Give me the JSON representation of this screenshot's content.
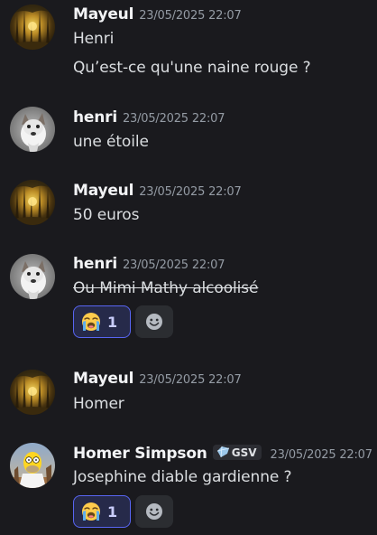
{
  "messages": [
    {
      "author": "Mayeul",
      "timestamp": "23/05/2025 22:07",
      "lines": [
        "Henri",
        "Qu’est-ce qu'une naine rouge ?"
      ],
      "avatar": "forest-avatar"
    },
    {
      "author": "henri",
      "timestamp": "23/05/2025 22:07",
      "lines": [
        "une étoile"
      ],
      "avatar": "dog-avatar"
    },
    {
      "author": "Mayeul",
      "timestamp": "23/05/2025 22:07",
      "lines": [
        "50 euros"
      ],
      "avatar": "forest-avatar"
    },
    {
      "author": "henri",
      "timestamp": "23/05/2025 22:07",
      "lines": [
        "Ou Mimi Mathy alcoolisé"
      ],
      "strikethrough": true,
      "avatar": "dog-avatar",
      "reactions": [
        {
          "emoji": "😭",
          "icon": "loudly-crying-face-icon",
          "count": "1"
        }
      ],
      "add_reaction_icon": "smiley-face-icon"
    },
    {
      "author": "Mayeul",
      "timestamp": "23/05/2025 22:07",
      "lines": [
        "Homer"
      ],
      "avatar": "forest-avatar"
    },
    {
      "author": "Homer Simpson",
      "tag": "GSV",
      "tag_icon": "blue-gem-icon",
      "timestamp": "23/05/2025 22:07",
      "lines": [
        "Josephine diable gardienne ?"
      ],
      "avatar": "homer-avatar",
      "reactions": [
        {
          "emoji": "😭",
          "icon": "loudly-crying-face-icon",
          "count": "1"
        }
      ],
      "add_reaction_icon": "smiley-face-icon"
    }
  ],
  "colors": {
    "background": "#1a1a1e",
    "author": "#f2f3f5",
    "timestamp": "#949ba4",
    "text": "#dbdee1",
    "reaction_bg": "#262a4a",
    "reaction_border": "#5865f2",
    "reaction_count": "#c9cdfb",
    "add_reaction_bg": "#2b2d31"
  }
}
